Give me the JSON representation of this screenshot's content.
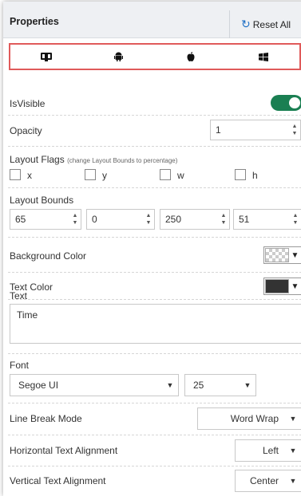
{
  "header": {
    "title": "Properties",
    "reset_label": "Reset All",
    "reset_icon": "refresh-icon",
    "accent": "#1e6fc5"
  },
  "platform_tabs": [
    {
      "name": "all-platforms",
      "icon": "monitor-mobile-icon"
    },
    {
      "name": "android",
      "icon": "android-icon"
    },
    {
      "name": "ios",
      "icon": "apple-icon"
    },
    {
      "name": "windows",
      "icon": "windows-icon"
    }
  ],
  "platform_bar_border_color": "#e05a5a",
  "is_visible": {
    "label": "IsVisible",
    "checked": true,
    "color": "#1a7f52"
  },
  "opacity": {
    "label": "Opacity",
    "value": "1"
  },
  "layout_flags": {
    "label": "Layout Flags",
    "note": "(change Layout Bounds to percentage)",
    "flags": [
      {
        "label": "x",
        "checked": false
      },
      {
        "label": "y",
        "checked": false
      },
      {
        "label": "w",
        "checked": false
      },
      {
        "label": "h",
        "checked": false
      }
    ]
  },
  "layout_bounds": {
    "label": "Layout Bounds",
    "values": [
      "65",
      "0",
      "250",
      "51"
    ]
  },
  "background_color": {
    "label": "Background Color",
    "swatch": "transparent"
  },
  "text_color": {
    "label": "Text Color",
    "swatch": "#333333"
  },
  "text": {
    "label": "Text",
    "value": "Time"
  },
  "font": {
    "label": "Font",
    "family": "Segoe UI",
    "size": "25"
  },
  "line_break_mode": {
    "label": "Line Break Mode",
    "value": "Word Wrap"
  },
  "horizontal_text_alignment": {
    "label": "Horizontal Text Alignment",
    "value": "Left"
  },
  "vertical_text_alignment": {
    "label": "Vertical Text Alignment",
    "value": "Center"
  }
}
